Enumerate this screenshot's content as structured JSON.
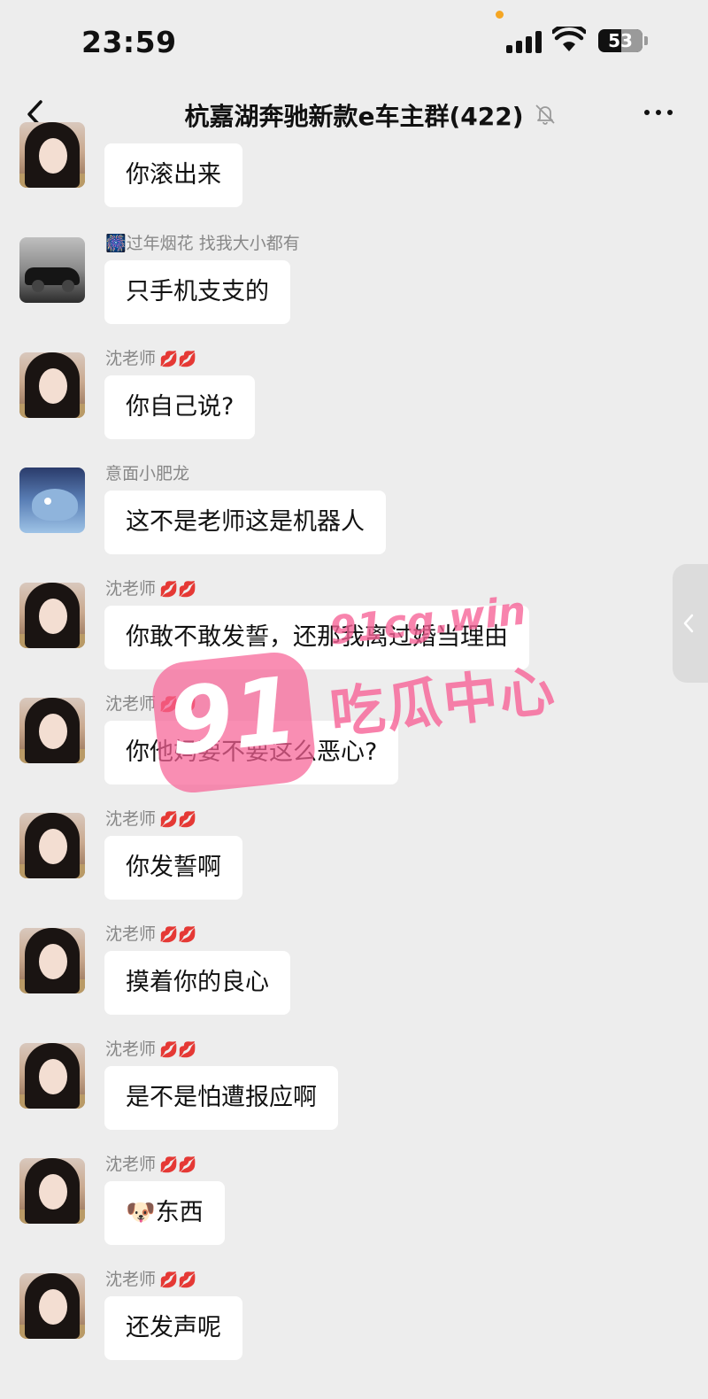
{
  "status_bar": {
    "time": "23:59",
    "battery_level": "53"
  },
  "header": {
    "title": "杭嘉湖奔驰新款e车主群(422)",
    "back_icon": "chevron-left-icon",
    "mute_icon": "bell-slash-icon",
    "more_icon": "ellipsis-icon"
  },
  "messages": [
    {
      "sender": "",
      "lips": "",
      "text": "你滚出来",
      "avatar": "girl"
    },
    {
      "sender": "🎆过年烟花 找我大小都有",
      "lips": "",
      "text": "只手机支支的",
      "avatar": "car"
    },
    {
      "sender": "沈老师",
      "lips": "💋💋",
      "text": "你自己说?",
      "avatar": "girl"
    },
    {
      "sender": "意面小肥龙",
      "lips": "",
      "text": "这不是老师这是机器人",
      "avatar": "shark"
    },
    {
      "sender": "沈老师",
      "lips": "💋💋",
      "text": "你敢不敢发誓，还那我离过婚当理由",
      "avatar": "girl"
    },
    {
      "sender": "沈老师",
      "lips": "💋💋",
      "text": "你他妈要不要这么恶心?",
      "avatar": "girl"
    },
    {
      "sender": "沈老师",
      "lips": "💋💋",
      "text": "你发誓啊",
      "avatar": "girl"
    },
    {
      "sender": "沈老师",
      "lips": "💋💋",
      "text": "摸着你的良心",
      "avatar": "girl"
    },
    {
      "sender": "沈老师",
      "lips": "💋💋",
      "text": "是不是怕遭报应啊",
      "avatar": "girl"
    },
    {
      "sender": "沈老师",
      "lips": "💋💋",
      "text": "🐶东西",
      "avatar": "girl"
    },
    {
      "sender": "沈老师",
      "lips": "💋💋",
      "text": "还发声呢",
      "avatar": "girl"
    }
  ],
  "watermark": {
    "badge": "91",
    "url": "91cg.win",
    "name": "吃瓜中心"
  },
  "colors": {
    "background": "#ededed",
    "bubble": "#ffffff",
    "watermark": "#f66296"
  }
}
